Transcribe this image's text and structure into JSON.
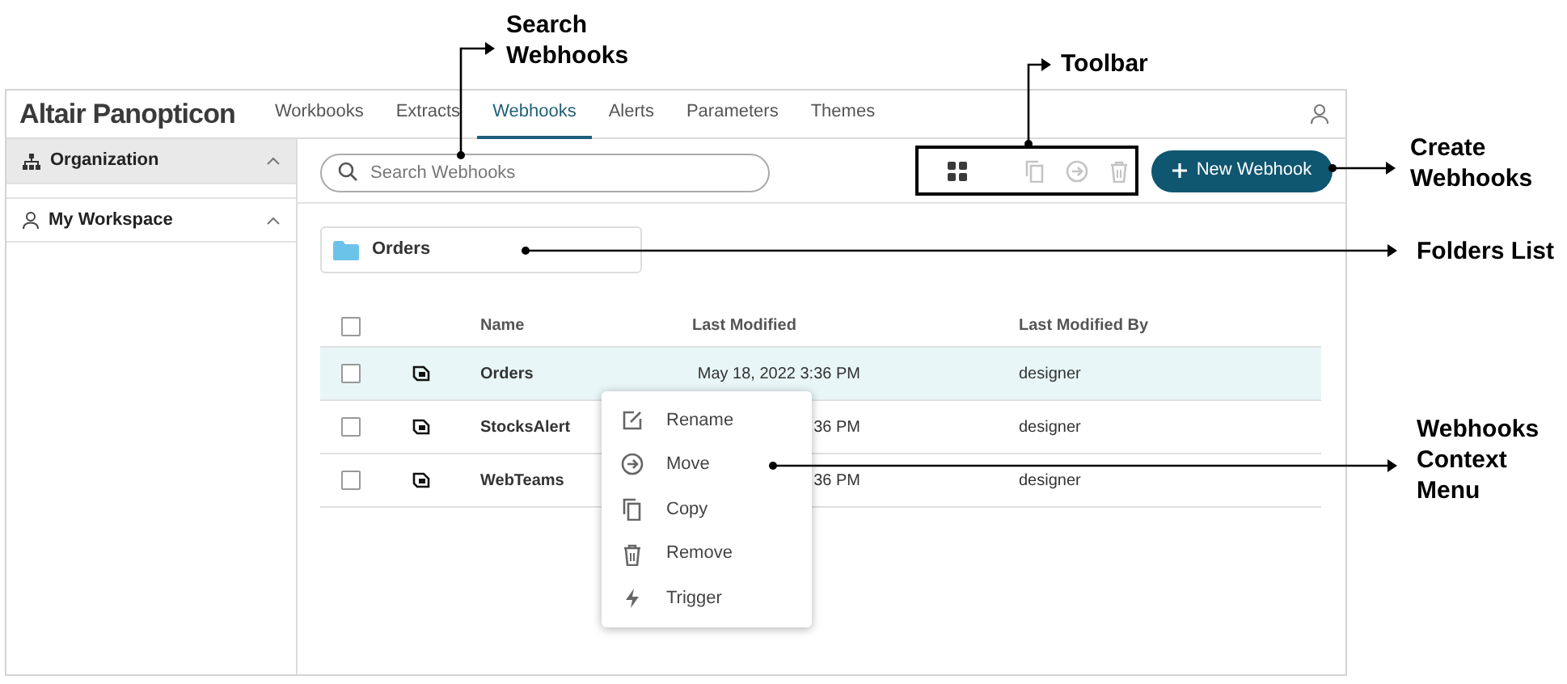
{
  "app": {
    "brand": "Altair Panopticon",
    "tabs": [
      {
        "label": "Workbooks",
        "selected": false
      },
      {
        "label": "Extracts",
        "selected": false
      },
      {
        "label": "Webhooks",
        "selected": true
      },
      {
        "label": "Alerts",
        "selected": false
      },
      {
        "label": "Parameters",
        "selected": false
      },
      {
        "label": "Themes",
        "selected": false
      }
    ],
    "sidebar": {
      "items": [
        {
          "kind": "organization",
          "label": "Organization",
          "selected": true,
          "expanded": true
        },
        {
          "kind": "workspace",
          "label": "My Workspace",
          "selected": false,
          "expanded": true
        }
      ]
    },
    "search": {
      "placeholder": "Search Webhooks"
    },
    "toolbar": [
      {
        "kind": "grid",
        "disabled": false
      },
      {
        "kind": "copy",
        "disabled": true
      },
      {
        "kind": "move",
        "disabled": true
      },
      {
        "kind": "remove",
        "disabled": true
      }
    ],
    "new_button": {
      "label": "New Webhook"
    },
    "folders": [
      {
        "name": "Orders"
      }
    ],
    "table": {
      "all_checked": false,
      "columns": [
        "Name",
        "Last Modified",
        "Last Modified By"
      ],
      "rows": [
        {
          "selected": true,
          "checked": false,
          "name": "Orders",
          "last_modified": "May 18, 2022 3:36 PM",
          "last_modified_by": "designer"
        },
        {
          "selected": false,
          "checked": false,
          "name": "StocksAlert",
          "last_modified": "36 PM",
          "last_modified_by": "designer"
        },
        {
          "selected": false,
          "checked": false,
          "name": "WebTeams",
          "last_modified": "36 PM",
          "last_modified_by": "designer"
        }
      ]
    },
    "context_menu": [
      {
        "kind": "rename",
        "label": "Rename"
      },
      {
        "kind": "move",
        "label": "Move"
      },
      {
        "kind": "copy",
        "label": "Copy"
      },
      {
        "kind": "remove",
        "label": "Remove"
      },
      {
        "kind": "trigger",
        "label": "Trigger"
      }
    ]
  },
  "callouts": [
    {
      "kind": "search",
      "text": "Search Webhooks"
    },
    {
      "kind": "toolbar",
      "text": "Toolbar"
    },
    {
      "kind": "create",
      "text": "Create Webhooks"
    },
    {
      "kind": "folders",
      "text": "Folders List"
    },
    {
      "kind": "context",
      "text": "Webhooks Context Menu"
    }
  ]
}
